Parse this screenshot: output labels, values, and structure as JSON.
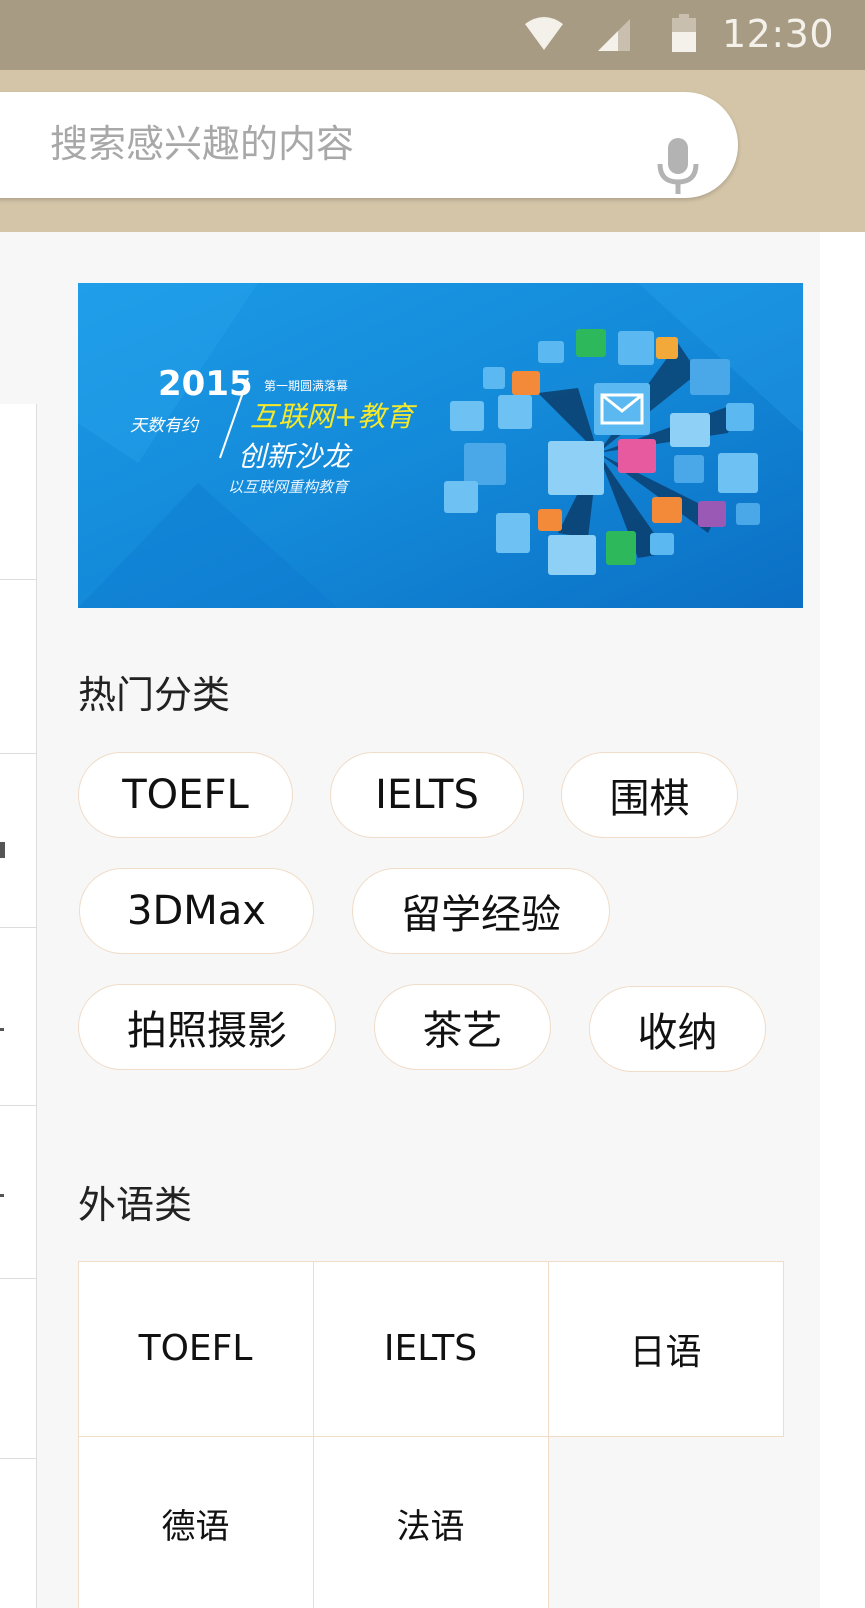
{
  "status_bar": {
    "time": "12:30",
    "icons": [
      "wifi-icon",
      "cell-signal-icon",
      "battery-icon"
    ]
  },
  "search": {
    "placeholder": "搜索感兴趣的内容",
    "value": "",
    "mic_icon": "microphone-icon"
  },
  "banner": {
    "year": "2015",
    "tagline_left": "天数有约",
    "kicker": "第一期圆满落幕",
    "headline": "互联网+教育",
    "subheadline": "创新沙龙",
    "slogan": "以互联网重构教育"
  },
  "hot_categories": {
    "title": "热门分类",
    "items": [
      {
        "label": "TOEFL"
      },
      {
        "label": "IELTS"
      },
      {
        "label": "围棋"
      },
      {
        "label": "3DMax"
      },
      {
        "label": "留学经验"
      },
      {
        "label": "拍照摄影"
      },
      {
        "label": "茶艺"
      },
      {
        "label": "收纳"
      }
    ]
  },
  "foreign_languages": {
    "title": "外语类",
    "items": [
      {
        "label": "TOEFL"
      },
      {
        "label": "IELTS"
      },
      {
        "label": "日语"
      },
      {
        "label": "德语"
      },
      {
        "label": "法语"
      }
    ]
  },
  "colors": {
    "status_bar": "#a89b84",
    "search_band": "#d4c5a8",
    "pill_border": "#f0dcc8",
    "banner_blue": "#1a8fdc"
  }
}
